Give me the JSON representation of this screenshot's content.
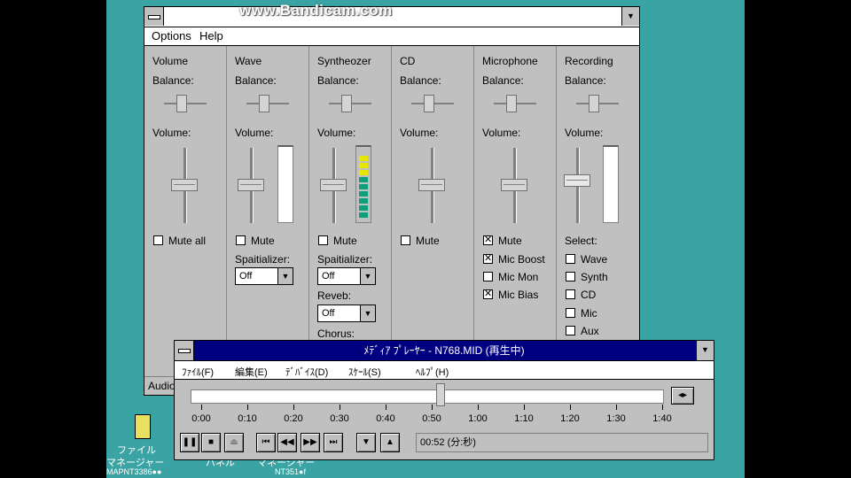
{
  "watermark": "www.Bandicam.com",
  "mixer": {
    "menu": [
      "Options",
      "Help"
    ],
    "balance_label": "Balance:",
    "volume_label": "Volume:",
    "status": "Audio",
    "columns": [
      {
        "title": "Volume",
        "checks": [
          {
            "label": "Mute all",
            "checked": false
          }
        ]
      },
      {
        "title": "Wave",
        "checks": [
          {
            "label": "Mute",
            "checked": false
          }
        ],
        "combos": [
          {
            "label": "Spaitializer:",
            "value": "Off"
          }
        ]
      },
      {
        "title": "Syntheozer",
        "checks": [
          {
            "label": "Mute",
            "checked": false
          }
        ],
        "combos": [
          {
            "label": "Spaitializer:",
            "value": "Off"
          },
          {
            "label": "Reveb:",
            "value": "Off"
          }
        ],
        "extra_label": "Chorus:"
      },
      {
        "title": "CD",
        "checks": [
          {
            "label": "Mute",
            "checked": false
          }
        ]
      },
      {
        "title": "Microphone",
        "checks": [
          {
            "label": "Mute",
            "checked": true
          },
          {
            "label": "Mic Boost",
            "checked": true
          },
          {
            "label": "Mic Mon",
            "checked": false
          },
          {
            "label": "Mic Bias",
            "checked": true
          }
        ]
      },
      {
        "title": "Recording",
        "select_label": "Select:",
        "checks": [
          {
            "label": "Wave",
            "checked": false
          },
          {
            "label": "Synth",
            "checked": false
          },
          {
            "label": "CD",
            "checked": false
          },
          {
            "label": "Mic",
            "checked": false
          },
          {
            "label": "Aux",
            "checked": false
          }
        ]
      }
    ]
  },
  "player": {
    "title": "ﾒﾃﾞｨｱ ﾌﾟﾚｰﾔｰ - N768.MID (再生中)",
    "menu": [
      "ﾌｧｲﾙ(F)",
      "編集(E)",
      "ﾃﾞﾊﾞｲｽ(D)",
      "ｽｹｰﾙ(S)",
      "ﾍﾙﾌﾟ(H)"
    ],
    "scale": [
      "0:00",
      "0:10",
      "0:20",
      "0:30",
      "0:40",
      "0:50",
      "1:00",
      "1:10",
      "1:20",
      "1:30",
      "1:40"
    ],
    "position": "00:52 (分:秒)",
    "progress_fraction": 0.52
  },
  "desktop": {
    "icon_label_1": "ファイル",
    "icon_label_2": "マネージャー",
    "icon_label_3": "パネル",
    "icon_label_4": "マネージャー",
    "footer_left": "MAPNT3386●●",
    "footer_right": "NT351●f"
  }
}
